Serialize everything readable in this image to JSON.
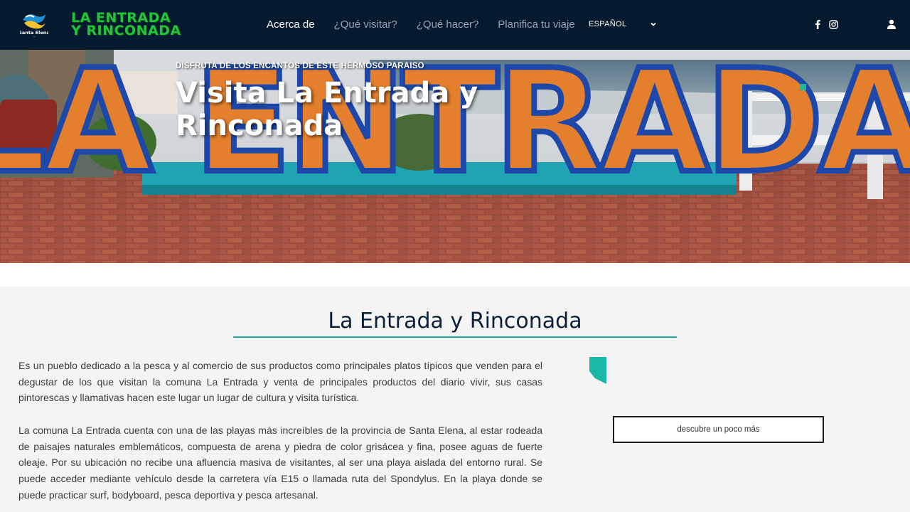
{
  "brand": {
    "badge_text": "Santa Elena",
    "title_line1": "LA ENTRADA",
    "title_line2": "Y RINCONADA"
  },
  "nav": {
    "items": [
      {
        "label": "Acerca de",
        "active": true
      },
      {
        "label": "¿Qué visitar?",
        "active": false
      },
      {
        "label": "¿Qué hacer?",
        "active": false
      },
      {
        "label": "Planifica tu viaje",
        "active": false
      }
    ],
    "language": "ESPAÑOL"
  },
  "icons": {
    "language_chevron": "chevron-down-icon",
    "facebook": "facebook-icon",
    "instagram": "instagram-icon",
    "user": "user-icon"
  },
  "hero": {
    "kicker": "DISFRUTA DE LOS ENCANTOS DE ESTE HERMOSO PARAISO",
    "title": "Visita La Entrada y Rinconada",
    "sign_text": "LA ENTRADA"
  },
  "content": {
    "title": "La Entrada y Rinconada",
    "paragraph1": "Es un pueblo dedicado a la pesca y al comercio de sus productos como principales platos típicos que venden para el degustar de los que visitan la comuna La Entrada y venta de principales productos del diario vivir, sus casas pintorescas y llamativas hacen este lugar un lugar de cultura y visita turística.",
    "paragraph2": "La comuna La Entrada cuenta con una de las playas más increíbles de la provincia de Santa Elena, al estar rodeada de paisajes naturales emblemáticos, compuesta de arena y piedra de color grisácea y fina, posee aguas de fuerte oleaje. Por su ubicación no recibe una afluencia masiva de visitantes, al ser una playa aislada del entorno rural. Se puede acceder mediante vehículo desde la carretera vía E15 o llamada ruta del Spondylus. En la playa donde se puede practicar surf, bodyboard, pesca deportiva y pesca artesanal.",
    "discover_button": "descubre un poco más"
  },
  "colors": {
    "header_bg": "#051a2e",
    "brand_green": "#22c53a",
    "accent_teal": "#20a9a4",
    "title_navy": "#0e1f3a"
  }
}
